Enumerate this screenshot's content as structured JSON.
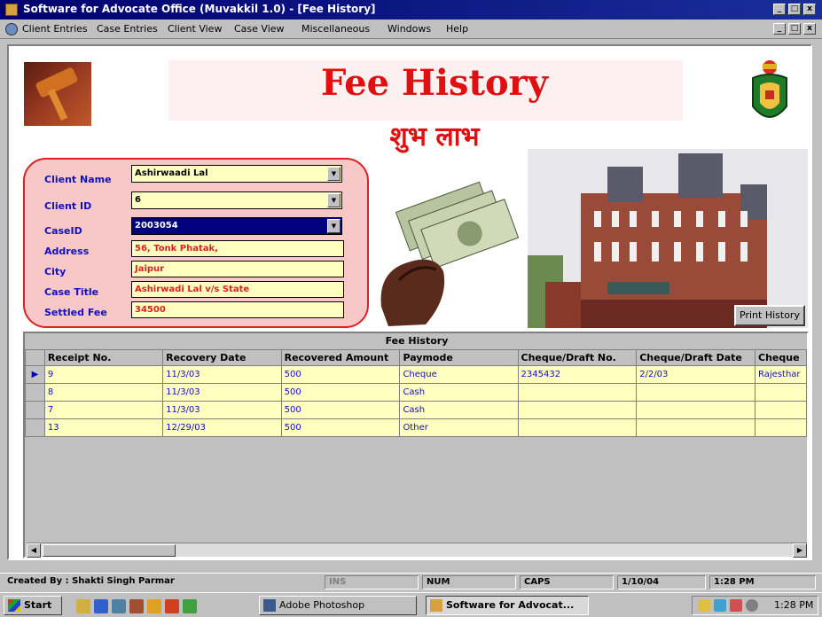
{
  "window": {
    "title": "Software for Advocate Office (Muvakkil 1.0) - [Fee History]",
    "controls": [
      "_",
      "□",
      "x"
    ]
  },
  "menu": {
    "items": [
      "Client Entries",
      "Case Entries",
      "Client View",
      "Case View",
      "Miscellaneous",
      "Windows",
      "Help"
    ]
  },
  "header": {
    "title": "Fee History",
    "subtitle": "शुभ लाभ"
  },
  "form": {
    "client_name_label": "Client Name",
    "client_name_value": "Ashirwaadi Lal",
    "client_id_label": "Client ID",
    "client_id_value": "6",
    "case_id_label": "CaseID",
    "case_id_value": "2003054",
    "address_label": "Address",
    "address_value": "56, Tonk Phatak,",
    "city_label": "City",
    "city_value": "Jaipur",
    "case_title_label": "Case Title",
    "case_title_value": "Ashirwadi Lal v/s State",
    "settled_fee_label": "Settled Fee",
    "settled_fee_value": "34500"
  },
  "print_button": "Print History",
  "grid": {
    "caption": "Fee History",
    "columns": [
      "Receipt No.",
      "Recovery Date",
      "Recovered Amount",
      "Paymode",
      "Cheque/Draft No.",
      "Cheque/Draft Date",
      "Cheque"
    ],
    "rows": [
      [
        "9",
        "11/3/03",
        "500",
        "Cheque",
        "2345432",
        "2/2/03",
        "Rajesthar"
      ],
      [
        "8",
        "11/3/03",
        "500",
        "Cash",
        "",
        "",
        ""
      ],
      [
        "7",
        "11/3/03",
        "500",
        "Cash",
        "",
        "",
        ""
      ],
      [
        "13",
        "12/29/03",
        "500",
        "Other",
        "",
        "",
        ""
      ]
    ],
    "current_row_marker": "▶"
  },
  "statusbar": {
    "created_by": "Created By : Shakti Singh Parmar",
    "ins": "INS",
    "num": "NUM",
    "caps": "CAPS",
    "date": "1/10/04",
    "time": "1:28 PM"
  },
  "taskbar": {
    "start": "Start",
    "apps": [
      "Adobe Photoshop",
      "Software for Advocat..."
    ],
    "clock": "1:28 PM"
  }
}
